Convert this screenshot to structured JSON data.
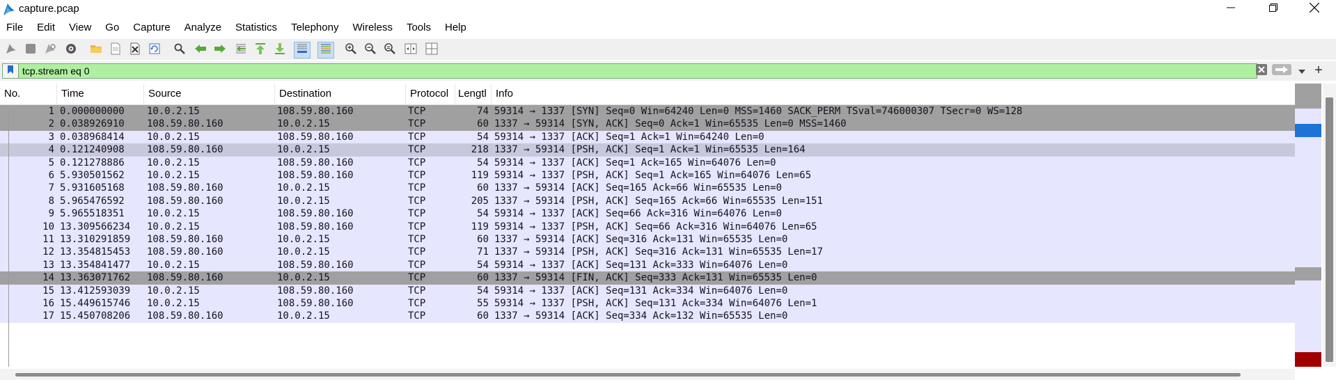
{
  "window": {
    "title": "capture.pcap",
    "icon": "wireshark-fin-icon",
    "controls": [
      "minimize-icon",
      "restore-icon",
      "close-icon"
    ]
  },
  "menu": {
    "items": [
      "File",
      "Edit",
      "View",
      "Go",
      "Capture",
      "Analyze",
      "Statistics",
      "Telephony",
      "Wireless",
      "Tools",
      "Help"
    ]
  },
  "toolbar": {
    "icons": [
      "shark-start-icon",
      "stop-square-icon",
      "restart-icon",
      "gear-icon",
      "folder-icon",
      "file-icon",
      "close-file-icon",
      "reload-icon",
      "search-icon",
      "arrow-left-icon",
      "arrow-right-icon",
      "go-to-packet-icon",
      "first-packet-icon",
      "last-packet-icon",
      "autoscroll-icon",
      "colorize-icon",
      "zoom-in-icon",
      "zoom-out-icon",
      "zoom-reset-icon",
      "resize-columns-icon",
      "layout-icon"
    ]
  },
  "filter": {
    "value": "tcp.stream eq 0",
    "plus": "+",
    "background": "#aff0a0"
  },
  "columns": {
    "no": "No.",
    "time": "Time",
    "source": "Source",
    "destination": "Destination",
    "protocol": "Protocol",
    "length": "Lengtl",
    "info": "Info"
  },
  "colors": {
    "row_default": "#e6e6ff",
    "row_dark": "#a0a0a0",
    "row_selected": "#c8c8dc",
    "minimap_blue": "#1e73d6",
    "minimap_red": "#a00000"
  },
  "packets": [
    {
      "no": "1",
      "time": "0.000000000",
      "src": "10.0.2.15",
      "dst": "108.59.80.160",
      "proto": "TCP",
      "len": "74",
      "info": "59314 → 1337 [SYN] Seq=0 Win=64240 Len=0 MSS=1460 SACK_PERM TSval=746000307 TSecr=0 WS=128",
      "style": "dark"
    },
    {
      "no": "2",
      "time": "0.038926910",
      "src": "108.59.80.160",
      "dst": "10.0.2.15",
      "proto": "TCP",
      "len": "60",
      "info": "1337 → 59314 [SYN, ACK] Seq=0 Ack=1 Win=65535 Len=0 MSS=1460",
      "style": "dark"
    },
    {
      "no": "3",
      "time": "0.038968414",
      "src": "10.0.2.15",
      "dst": "108.59.80.160",
      "proto": "TCP",
      "len": "54",
      "info": "59314 → 1337 [ACK] Seq=1 Ack=1 Win=64240 Len=0",
      "style": "default"
    },
    {
      "no": "4",
      "time": "0.121240908",
      "src": "108.59.80.160",
      "dst": "10.0.2.15",
      "proto": "TCP",
      "len": "218",
      "info": "1337 → 59314 [PSH, ACK] Seq=1 Ack=1 Win=65535 Len=164",
      "style": "selected"
    },
    {
      "no": "5",
      "time": "0.121278886",
      "src": "10.0.2.15",
      "dst": "108.59.80.160",
      "proto": "TCP",
      "len": "54",
      "info": "59314 → 1337 [ACK] Seq=1 Ack=165 Win=64076 Len=0",
      "style": "default"
    },
    {
      "no": "6",
      "time": "5.930501562",
      "src": "10.0.2.15",
      "dst": "108.59.80.160",
      "proto": "TCP",
      "len": "119",
      "info": "59314 → 1337 [PSH, ACK] Seq=1 Ack=165 Win=64076 Len=65",
      "style": "default"
    },
    {
      "no": "7",
      "time": "5.931605168",
      "src": "108.59.80.160",
      "dst": "10.0.2.15",
      "proto": "TCP",
      "len": "60",
      "info": "1337 → 59314 [ACK] Seq=165 Ack=66 Win=65535 Len=0",
      "style": "default"
    },
    {
      "no": "8",
      "time": "5.965476592",
      "src": "108.59.80.160",
      "dst": "10.0.2.15",
      "proto": "TCP",
      "len": "205",
      "info": "1337 → 59314 [PSH, ACK] Seq=165 Ack=66 Win=65535 Len=151",
      "style": "default"
    },
    {
      "no": "9",
      "time": "5.965518351",
      "src": "10.0.2.15",
      "dst": "108.59.80.160",
      "proto": "TCP",
      "len": "54",
      "info": "59314 → 1337 [ACK] Seq=66 Ack=316 Win=64076 Len=0",
      "style": "default"
    },
    {
      "no": "10",
      "time": "13.309566234",
      "src": "10.0.2.15",
      "dst": "108.59.80.160",
      "proto": "TCP",
      "len": "119",
      "info": "59314 → 1337 [PSH, ACK] Seq=66 Ack=316 Win=64076 Len=65",
      "style": "default"
    },
    {
      "no": "11",
      "time": "13.310291859",
      "src": "108.59.80.160",
      "dst": "10.0.2.15",
      "proto": "TCP",
      "len": "60",
      "info": "1337 → 59314 [ACK] Seq=316 Ack=131 Win=65535 Len=0",
      "style": "default"
    },
    {
      "no": "12",
      "time": "13.354815453",
      "src": "108.59.80.160",
      "dst": "10.0.2.15",
      "proto": "TCP",
      "len": "71",
      "info": "1337 → 59314 [PSH, ACK] Seq=316 Ack=131 Win=65535 Len=17",
      "style": "default"
    },
    {
      "no": "13",
      "time": "13.354841477",
      "src": "10.0.2.15",
      "dst": "108.59.80.160",
      "proto": "TCP",
      "len": "54",
      "info": "59314 → 1337 [ACK] Seq=131 Ack=333 Win=64076 Len=0",
      "style": "default"
    },
    {
      "no": "14",
      "time": "13.363071762",
      "src": "108.59.80.160",
      "dst": "10.0.2.15",
      "proto": "TCP",
      "len": "60",
      "info": "1337 → 59314 [FIN, ACK] Seq=333 Ack=131 Win=65535 Len=0",
      "style": "dark"
    },
    {
      "no": "15",
      "time": "13.412593039",
      "src": "10.0.2.15",
      "dst": "108.59.80.160",
      "proto": "TCP",
      "len": "54",
      "info": "59314 → 1337 [ACK] Seq=131 Ack=334 Win=64076 Len=0",
      "style": "default"
    },
    {
      "no": "16",
      "time": "15.449615746",
      "src": "10.0.2.15",
      "dst": "108.59.80.160",
      "proto": "TCP",
      "len": "55",
      "info": "59314 → 1337 [PSH, ACK] Seq=131 Ack=334 Win=64076 Len=1",
      "style": "default"
    },
    {
      "no": "17",
      "time": "15.450708206",
      "src": "108.59.80.160",
      "dst": "10.0.2.15",
      "proto": "TCP",
      "len": "60",
      "info": "1337 → 59314 [ACK] Seq=334 Ack=132 Win=65535 Len=0",
      "style": "default"
    }
  ]
}
